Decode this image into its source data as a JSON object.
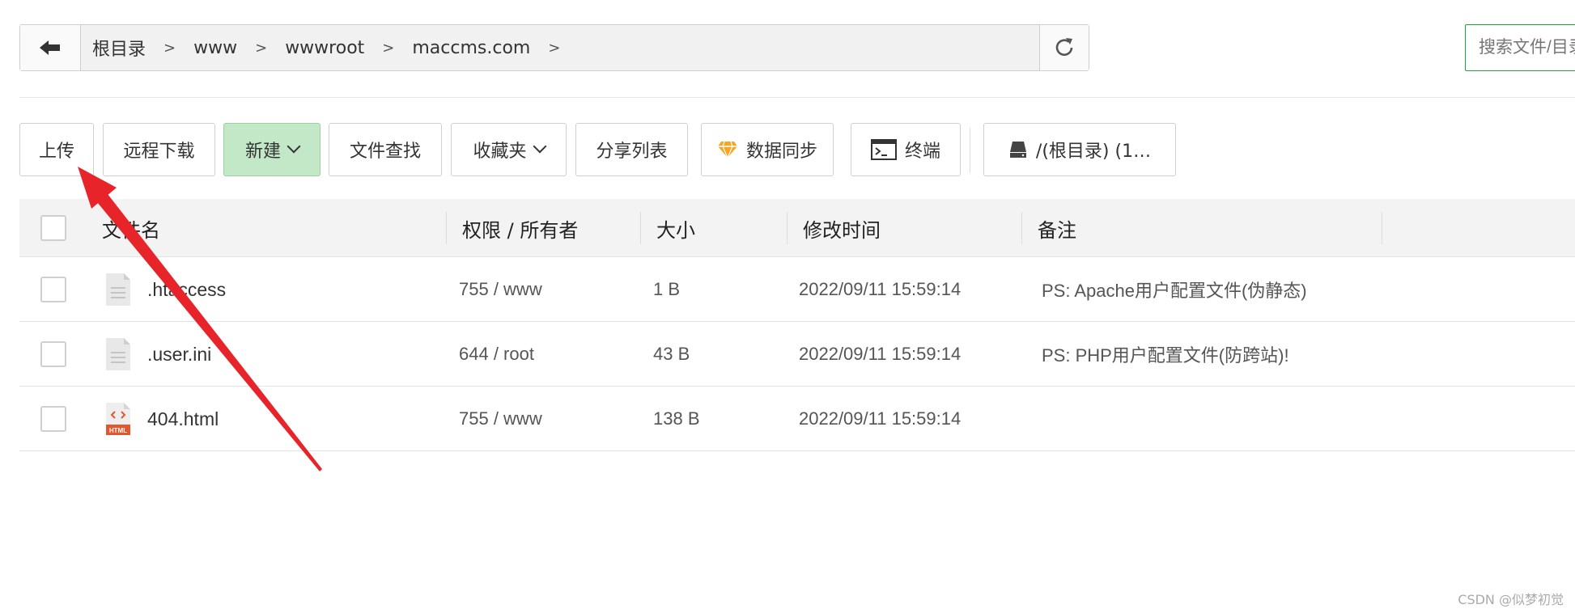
{
  "breadcrumb": {
    "items": [
      "根目录",
      "www",
      "wwwroot",
      "maccms.com"
    ],
    "separator": ">"
  },
  "search": {
    "placeholder": "搜索文件/目录"
  },
  "toolbar": {
    "upload": "上传",
    "remote_download": "远程下载",
    "new": "新建",
    "file_search": "文件查找",
    "favorites": "收藏夹",
    "share_list": "分享列表",
    "data_sync": "数据同步",
    "terminal": "终端",
    "disk": "/(根目录) (1…"
  },
  "table": {
    "headers": {
      "name": "文件名",
      "perm_owner": "权限 / 所有者",
      "size": "大小",
      "mtime": "修改时间",
      "note": "备注"
    },
    "rows": [
      {
        "name": ".htaccess",
        "perm": "755 / www",
        "size": "1 B",
        "mtime": "2022/09/11 15:59:14",
        "note": "PS: Apache用户配置文件(伪静态)",
        "icon": "text-file-icon"
      },
      {
        "name": ".user.ini",
        "perm": "644 / root",
        "size": "43 B",
        "mtime": "2022/09/11 15:59:14",
        "note": "PS: PHP用户配置文件(防跨站)!",
        "icon": "text-file-icon"
      },
      {
        "name": "404.html",
        "perm": "755 / www",
        "size": "138 B",
        "mtime": "2022/09/11 15:59:14",
        "note": "",
        "icon": "html-file-icon"
      }
    ]
  },
  "html_badge": "HTML",
  "watermark": "CSDN @似梦初觉",
  "colors": {
    "accent": "#20a53a",
    "new_button_bg": "#c3e8c7",
    "arrow": "#e8242b",
    "diamond": "#f5a623"
  }
}
